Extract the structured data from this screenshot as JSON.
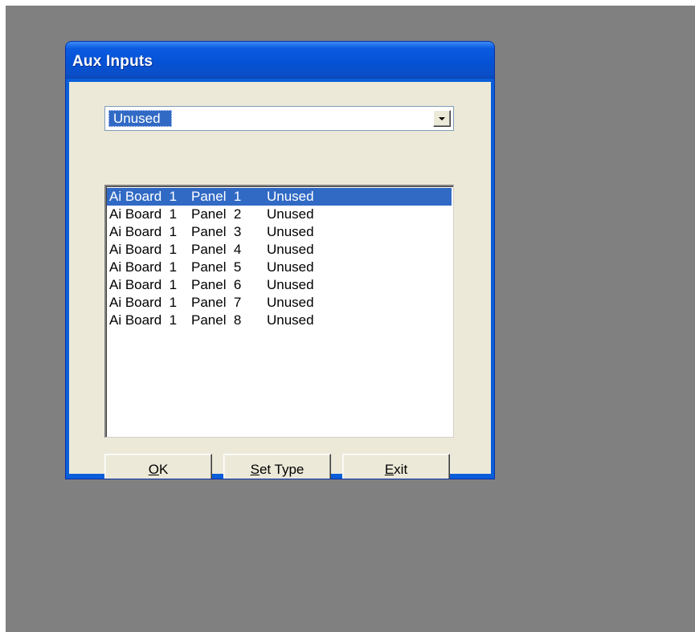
{
  "window": {
    "title": "Aux Inputs"
  },
  "combo": {
    "selected": "Unused"
  },
  "list": {
    "items": [
      {
        "board": "Ai Board  1",
        "panel": "Panel  1",
        "status": "Unused",
        "selected": true
      },
      {
        "board": "Ai Board  1",
        "panel": "Panel  2",
        "status": "Unused",
        "selected": false
      },
      {
        "board": "Ai Board  1",
        "panel": "Panel  3",
        "status": "Unused",
        "selected": false
      },
      {
        "board": "Ai Board  1",
        "panel": "Panel  4",
        "status": "Unused",
        "selected": false
      },
      {
        "board": "Ai Board  1",
        "panel": "Panel  5",
        "status": "Unused",
        "selected": false
      },
      {
        "board": "Ai Board  1",
        "panel": "Panel  6",
        "status": "Unused",
        "selected": false
      },
      {
        "board": "Ai Board  1",
        "panel": "Panel  7",
        "status": "Unused",
        "selected": false
      },
      {
        "board": "Ai Board  1",
        "panel": "Panel  8",
        "status": "Unused",
        "selected": false
      }
    ]
  },
  "buttons": {
    "ok": {
      "mnemonic": "O",
      "rest": "K"
    },
    "set_type": {
      "mnemonic": "S",
      "rest": "et Type"
    },
    "exit": {
      "mnemonic": "E",
      "rest": "xit"
    }
  },
  "colors": {
    "desktop": "#808080",
    "titlebar": "#0552d6",
    "dialog_face": "#ece9d8",
    "selection": "#316ac5"
  },
  "icons": {
    "combo_arrow": "chevron-down-icon"
  }
}
